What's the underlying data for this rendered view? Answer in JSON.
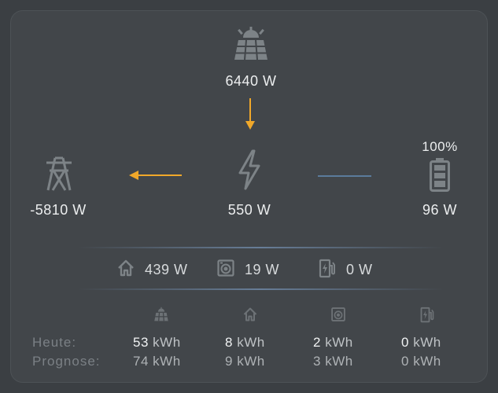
{
  "flow": {
    "solar": {
      "value": "6440 W",
      "icon": "solar-panel-icon"
    },
    "grid": {
      "value": "-5810 W",
      "icon": "transmission-tower-icon"
    },
    "home": {
      "value": "550 W",
      "icon": "lightning-bolt-icon"
    },
    "battery": {
      "value": "96 W",
      "level": "100%",
      "icon": "battery-full-icon"
    }
  },
  "consumers": [
    {
      "icon": "house-icon",
      "value": "439 W"
    },
    {
      "icon": "washing-machine-icon",
      "value": "19 W"
    },
    {
      "icon": "ev-charger-icon",
      "value": "0 W"
    }
  ],
  "stats": {
    "row_labels": [
      "Heute:",
      "Prognose:"
    ],
    "columns": [
      {
        "icon": "solar-panel-icon",
        "today": "53",
        "forecast": "74"
      },
      {
        "icon": "house-icon",
        "today": "8",
        "forecast": "9"
      },
      {
        "icon": "washing-machine-icon",
        "today": "2",
        "forecast": "3"
      },
      {
        "icon": "ev-charger-icon",
        "today": "0",
        "forecast": "0"
      }
    ],
    "unit": "kWh"
  },
  "colors": {
    "background": "#3b3f43",
    "card": "#42464a",
    "icon": "#7d8387",
    "flow_arrow": "#f0a82a",
    "battery_line": "#5b7b9c"
  }
}
